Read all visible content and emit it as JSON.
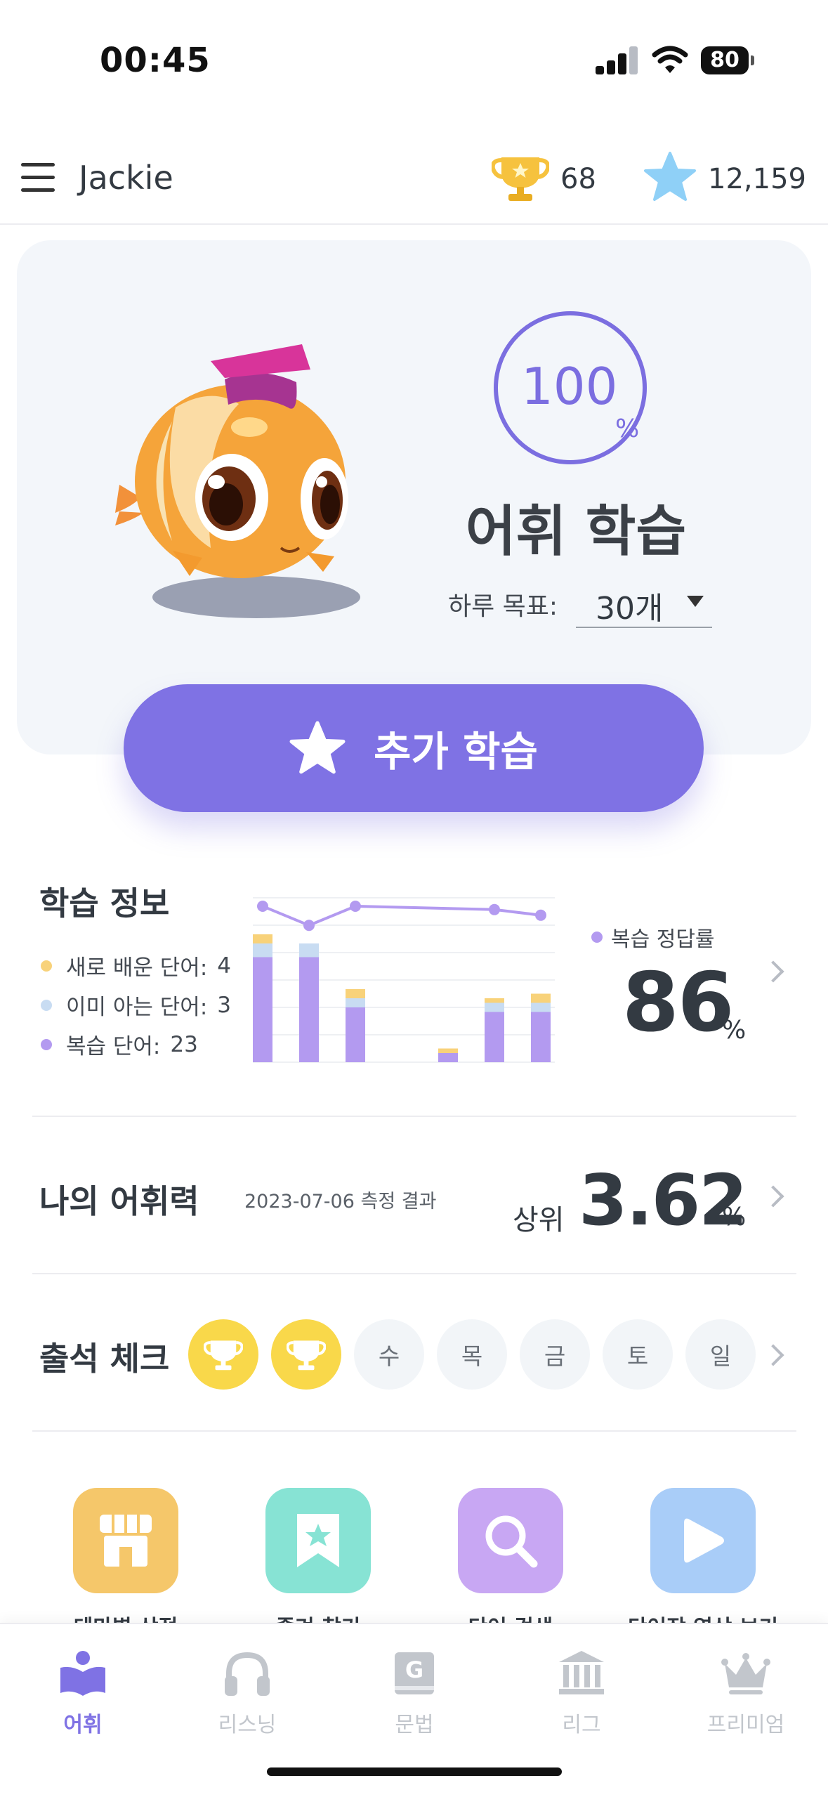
{
  "status_bar": {
    "time": "00:45",
    "battery": "80"
  },
  "header": {
    "user_name": "Jackie",
    "trophy_count": "68",
    "star_count": "12,159"
  },
  "hero": {
    "progress_value": "100",
    "progress_unit": "%",
    "progress_fraction": 1.0,
    "title": "어휘 학습",
    "goal_label": "하루 목표:",
    "goal_value": "30개",
    "extra_button": "추가 학습"
  },
  "stats": {
    "title": "학습 정보",
    "legend": [
      {
        "label": "새로 배운 단어:",
        "value": "4",
        "color": "#f8d27a"
      },
      {
        "label": "이미 아는 단어:",
        "value": "3",
        "color": "#c8dcf2"
      },
      {
        "label": "복습 단어:",
        "value": "23",
        "color": "#b39af0"
      }
    ],
    "accuracy_label": "복습 정답률",
    "accuracy_value": "86",
    "accuracy_unit": "%"
  },
  "chart_data": {
    "type": "bar",
    "stacked": true,
    "series": [
      {
        "name": "복습 단어",
        "color": "#b39af0",
        "values": [
          23,
          23,
          12,
          0,
          2,
          11,
          11
        ]
      },
      {
        "name": "이미 아는 단어",
        "color": "#c8dcf2",
        "values": [
          3,
          3,
          2,
          0,
          0,
          2,
          2
        ]
      },
      {
        "name": "새로 배운 단어",
        "color": "#f8d27a",
        "values": [
          2,
          0,
          2,
          0,
          1,
          1,
          2
        ]
      }
    ],
    "line": {
      "name": "복습 정답률",
      "color": "#b39af0",
      "values": [
        100,
        83,
        100,
        null,
        null,
        97,
        92
      ]
    },
    "ylim": [
      0,
      36
    ],
    "line_ylim": [
      0,
      100
    ]
  },
  "vocab": {
    "title": "나의 어휘력",
    "date": "2023-07-06 측정 결과",
    "prefix": "상위",
    "value": "3.62",
    "unit": "%"
  },
  "attendance": {
    "title": "출석 체크",
    "days": [
      {
        "label": "",
        "done": true
      },
      {
        "label": "",
        "done": true
      },
      {
        "label": "수",
        "done": false
      },
      {
        "label": "목",
        "done": false
      },
      {
        "label": "금",
        "done": false
      },
      {
        "label": "토",
        "done": false
      },
      {
        "label": "일",
        "done": false
      }
    ]
  },
  "quick_actions": [
    {
      "icon": "store-icon",
      "label": "테마별 상점",
      "color": "#f5c76a"
    },
    {
      "icon": "bookmark-star-icon",
      "label": "즐겨 찾기",
      "color": "#87e3d4"
    },
    {
      "icon": "search-icon",
      "label": "단어 검색",
      "color": "#c8a7f3"
    },
    {
      "icon": "play-icon",
      "label": "단어장 영상 보기",
      "color": "#a9cdf8"
    }
  ],
  "tabs": [
    {
      "label": "어휘",
      "icon": "book-icon",
      "active": true
    },
    {
      "label": "리스닝",
      "icon": "headphones-icon",
      "active": false
    },
    {
      "label": "문법",
      "icon": "grammar-g-icon",
      "active": false
    },
    {
      "label": "리그",
      "icon": "league-building-icon",
      "active": false
    },
    {
      "label": "프리미엄",
      "icon": "crown-icon",
      "active": false
    }
  ]
}
